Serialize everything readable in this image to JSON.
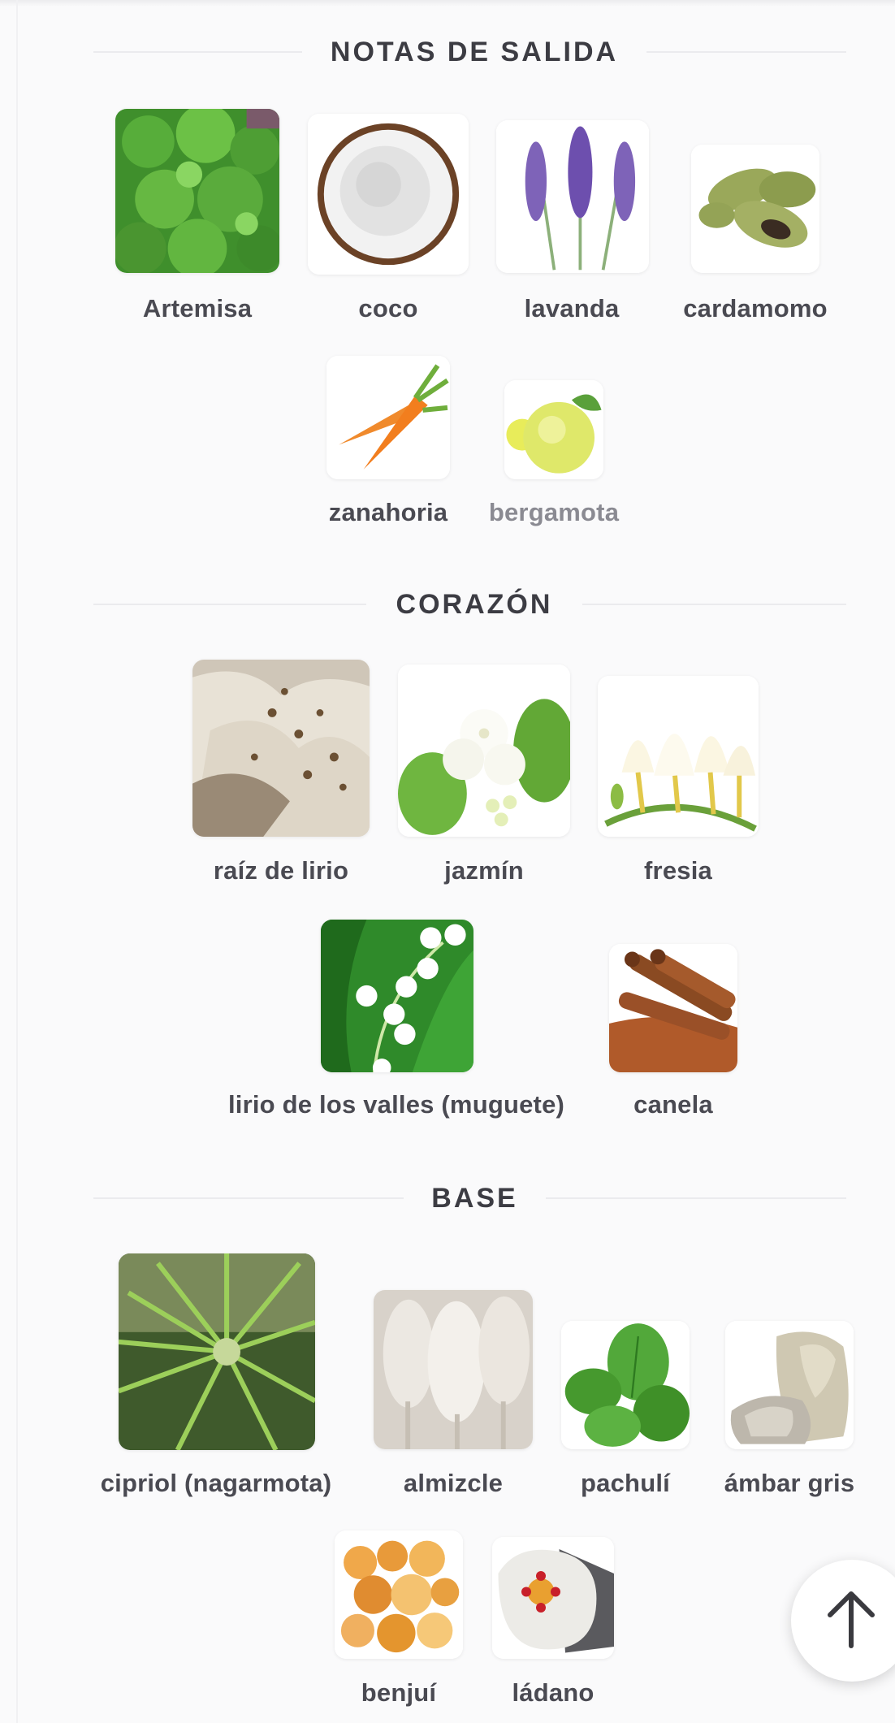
{
  "sections": [
    {
      "title": "NOTAS DE SALIDA",
      "notes": [
        {
          "label": "Artemisa"
        },
        {
          "label": "coco"
        },
        {
          "label": "lavanda"
        },
        {
          "label": "cardamomo"
        },
        {
          "label": "zanahoria"
        },
        {
          "label": "bergamota"
        }
      ]
    },
    {
      "title": "CORAZÓN",
      "notes": [
        {
          "label": "raíz de lirio"
        },
        {
          "label": "jazmín"
        },
        {
          "label": "fresia"
        },
        {
          "label": "lirio de los valles (muguete)"
        },
        {
          "label": "canela"
        }
      ]
    },
    {
      "title": "BASE",
      "notes": [
        {
          "label": "cipriol (nagarmota)"
        },
        {
          "label": "almizcle"
        },
        {
          "label": "pachulí"
        },
        {
          "label": "ámbar gris"
        },
        {
          "label": "benjuí"
        },
        {
          "label": "ládano"
        }
      ]
    }
  ],
  "colors": {
    "background": "#fafafb",
    "text": "#4a4a52",
    "heading": "#3c3c43",
    "muted": "#8a8a92"
  },
  "back_to_top": {
    "icon": "arrow-up-icon"
  }
}
